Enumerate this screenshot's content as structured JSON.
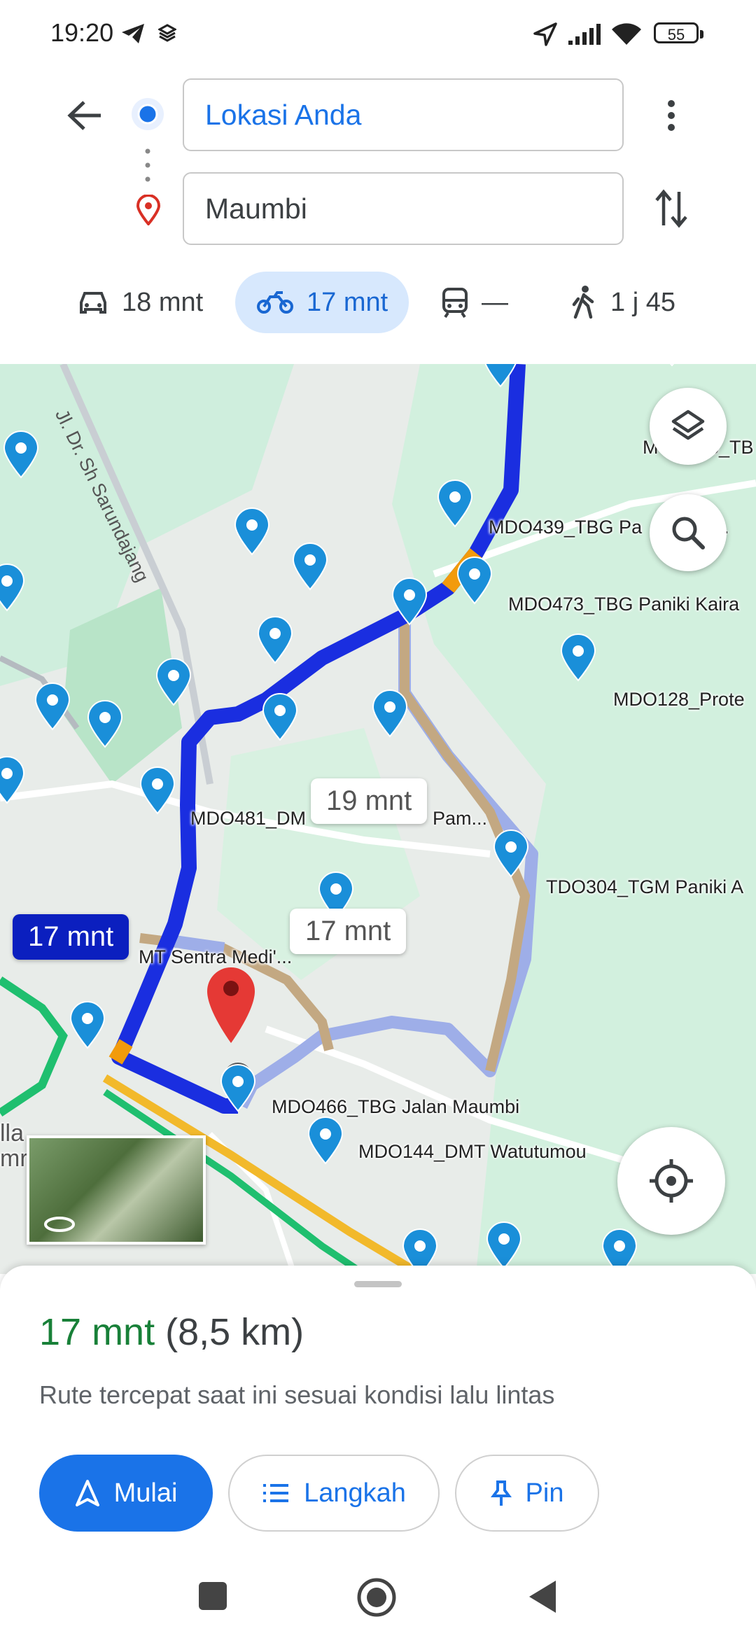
{
  "status_bar": {
    "time": "19:20",
    "battery": "55"
  },
  "directions": {
    "origin": "Lokasi Anda",
    "destination": "Maumbi"
  },
  "modes": [
    {
      "name": "car",
      "label": "18 mnt"
    },
    {
      "name": "motorcycle",
      "label": "17 mnt",
      "selected": true
    },
    {
      "name": "transit",
      "label": "—"
    },
    {
      "name": "walk",
      "label": "1 j 45"
    }
  ],
  "map": {
    "road_label": "Jl. Dr. Sh Sarundajang",
    "pin_labels": [
      "MDO439_TBG Pa",
      "ar..",
      "MDO473_TBG Paniki Kaira",
      "MDO128_Prote",
      "MDO481_DM",
      "Pam...",
      "TDO304_TGM Paniki A",
      "MT Sentra Medi'...",
      "MDO466_TBG Jalan Maumbi",
      "MDO144_DMT Watutumou",
      "M",
      "5_TB"
    ],
    "route_times": {
      "alt1": "19 mnt",
      "alt2": "17 mnt",
      "selected": "17 mnt"
    },
    "edge_labels": [
      "lla",
      "mr"
    ]
  },
  "summary": {
    "duration": "17 mnt",
    "distance": "(8,5 km)",
    "description": "Rute tercepat saat ini sesuai kondisi lalu lintas"
  },
  "actions": {
    "start": "Mulai",
    "steps": "Langkah",
    "pin": "Pin"
  },
  "colors": {
    "accent": "#1a73e8",
    "route": "#1a2ee0",
    "alt_route": "#c3a882",
    "duration_green": "#188038",
    "map_bg": "#e8ece9"
  }
}
